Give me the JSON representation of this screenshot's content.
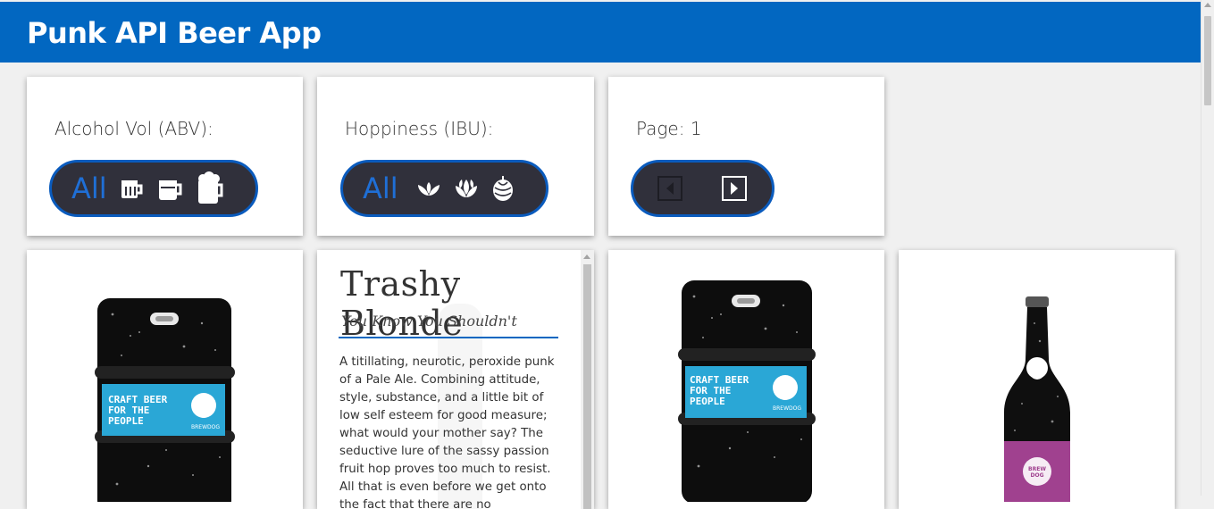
{
  "app": {
    "title": "Punk API Beer App"
  },
  "filters": {
    "abv": {
      "label": "Alcohol Vol (ABV):",
      "all_label": "All",
      "icons": [
        "mug-small-icon",
        "mug-medium-icon",
        "mug-large-icon"
      ]
    },
    "ibu": {
      "label": "Hoppiness (IBU):",
      "all_label": "All",
      "icons": [
        "hop-small-icon",
        "hop-medium-icon",
        "hop-large-icon"
      ]
    },
    "page": {
      "label": "Page: 1",
      "prev_icon": "prev-page-icon",
      "next_icon": "next-page-icon"
    }
  },
  "beers": [
    {
      "image": "keg-icon",
      "label_text": "CRAFT BEER FOR THE PEOPLE",
      "brand": "BREWDOG"
    },
    {
      "name": "Trashy Blonde",
      "tagline": "You Know You Shouldn't",
      "description": "A titillating, neurotic, peroxide punk of a Pale Ale. Combining attitude, style, substance, and a little bit of low self esteem for good measure; what would your mother say? The seductive lure of the sassy passion fruit hop proves too much to resist. All that is even before we get onto the fact that there are no"
    },
    {
      "image": "keg-icon",
      "label_text": "CRAFT BEER FOR THE PEOPLE",
      "brand": "BREWDOG"
    },
    {
      "image": "bottle-icon",
      "brand": "BREW DOG"
    }
  ],
  "colors": {
    "header": "#0267c1",
    "pill_bg": "#30303b",
    "accent": "#1f6fd6",
    "label_blue": "#2aa7d6",
    "bottle_label": "#a0418f"
  }
}
